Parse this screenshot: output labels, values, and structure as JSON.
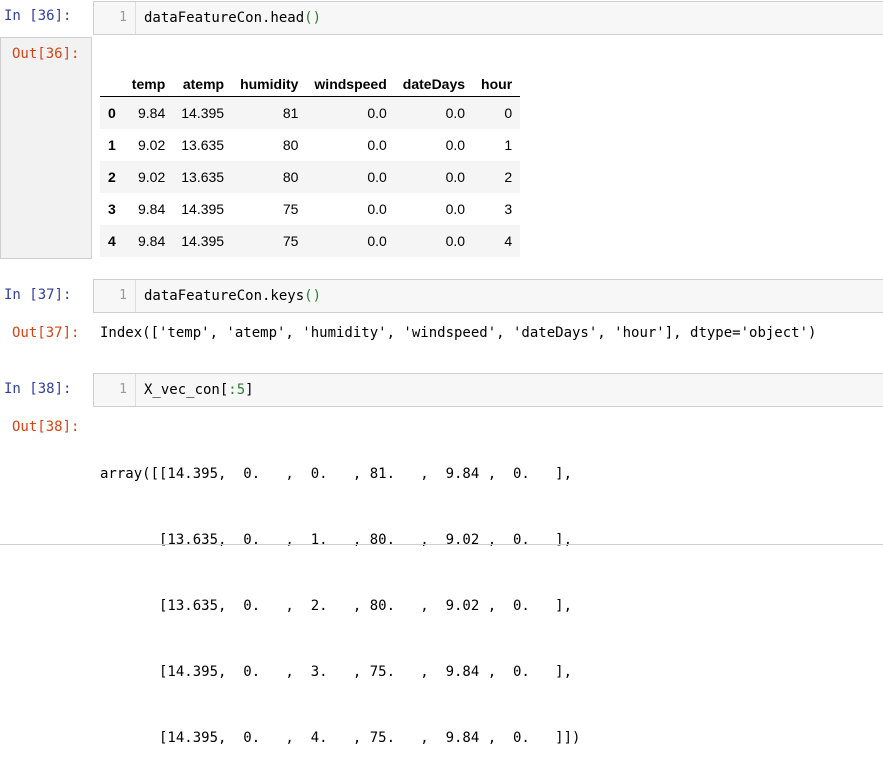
{
  "cells": [
    {
      "in_prompt": "In  [36]:",
      "line_no": "1",
      "code_pre": "dataFeatureCon.head",
      "code_paren": "()",
      "out_prompt": "Out[36]:",
      "table": {
        "columns": [
          "",
          "temp",
          "atemp",
          "humidity",
          "windspeed",
          "dateDays",
          "hour"
        ],
        "rows": [
          [
            "0",
            "9.84",
            "14.395",
            "81",
            "0.0",
            "0.0",
            "0"
          ],
          [
            "1",
            "9.02",
            "13.635",
            "80",
            "0.0",
            "0.0",
            "1"
          ],
          [
            "2",
            "9.02",
            "13.635",
            "80",
            "0.0",
            "0.0",
            "2"
          ],
          [
            "3",
            "9.84",
            "14.395",
            "75",
            "0.0",
            "0.0",
            "3"
          ],
          [
            "4",
            "9.84",
            "14.395",
            "75",
            "0.0",
            "0.0",
            "4"
          ]
        ]
      }
    },
    {
      "in_prompt": "In  [37]:",
      "line_no": "1",
      "code_pre": "dataFeatureCon.keys",
      "code_paren": "()",
      "out_prompt": "Out[37]:",
      "output": "Index(['temp', 'atemp', 'humidity', 'windspeed', 'dateDays', 'hour'], dtype='object')"
    },
    {
      "in_prompt": "In  [38]:",
      "line_no": "1",
      "code_pre": "X_vec_con[",
      "code_num": ":5",
      "code_post": "]",
      "out_prompt": "Out[38]:",
      "output_lines": [
        "array([[14.395,  0.   ,  0.   , 81.   ,  9.84 ,  0.   ],",
        "       [13.635,  0.   ,  1.   , 80.   ,  9.02 ,  0.   ],",
        "       [13.635,  0.   ,  2.   , 80.   ,  9.02 ,  0.   ],",
        "       [14.395,  0.   ,  3.   , 75.   ,  9.84 ,  0.   ],",
        "       [14.395,  0.   ,  4.   , 75.   ,  9.84 ,  0.   ]])"
      ]
    }
  ],
  "colors": {
    "in_prompt": "#303f9f",
    "out_prompt": "#d84315",
    "paren": "#2e7d32"
  }
}
